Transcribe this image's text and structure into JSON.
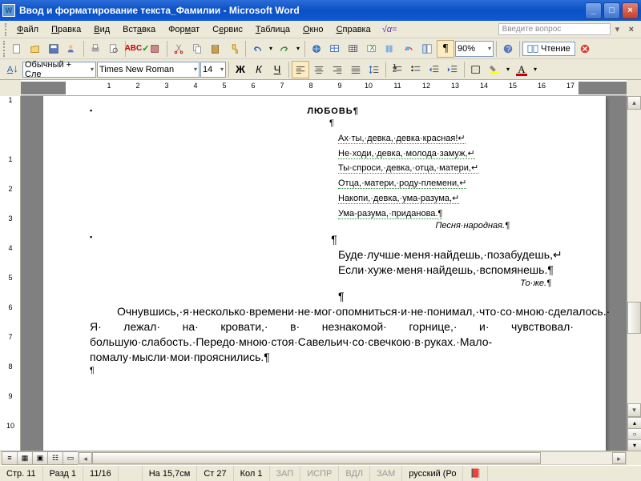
{
  "window": {
    "title": "Ввод и форматирование текста_Фамилии - Microsoft Word"
  },
  "menu": {
    "file": "Файл",
    "edit": "Правка",
    "view": "Вид",
    "insert": "Вставка",
    "format": "Формат",
    "tools": "Сервис",
    "table": "Таблица",
    "window": "Окно",
    "help": "Справка",
    "formula": "√α=",
    "question": "Введите вопрос"
  },
  "tb1": {
    "zoom": "90%",
    "reading": "Чтение"
  },
  "tb2": {
    "style": "Обычный + Сле",
    "font": "Times New Roman",
    "size": "14",
    "bold": "Ж",
    "italic": "К",
    "underline": "Ч"
  },
  "ruler_h": [
    "",
    "1",
    "2",
    "3",
    "4",
    "5",
    "6",
    "7",
    "8",
    "9",
    "10",
    "11",
    "12",
    "13",
    "14",
    "15",
    "16",
    "17"
  ],
  "ruler_v": [
    "1",
    "",
    "1",
    "2",
    "3",
    "4",
    "5",
    "6",
    "7",
    "8",
    "9",
    "10"
  ],
  "doc": {
    "title": "ЛЮБОВЬ¶",
    "p1": "¶",
    "poem": [
      "Ах·ты,·девка,·девка·красная!↵",
      "Не·ходи,·девка,·молода·замуж,↵",
      "Ты·спроси,·девка,·отца,·матери,↵",
      "Отца,·матери,·роду-племени,↵",
      "Накопи,·девка,·ума-разума,↵",
      "Ума-разума,·приданова.¶"
    ],
    "src": "Песня·народная.¶",
    "p2": "¶",
    "poem2": [
      "Буде·лучше·меня·найдешь,·позабудешь,↵",
      "Если·хуже·меня·найдешь,·вспомянешь.¶"
    ],
    "src2": "То·же.¶",
    "p3": "¶",
    "prose": "Очнувшись,·я·несколько·времени·не·мог·опомниться·и·не·понимал,·что·со·мною·сделалось.· Я· лежал· на· кровати,· в· незнакомой· горнице,· и· чувствовал· большую·слабость.·Передо·мною·стоя·Савельич·со·свечкою·в·руках.·Мало-помалу·мысли·мои·прояснились.¶",
    "p4": "¶"
  },
  "status": {
    "page": "Стр. 11",
    "sect": "Разд 1",
    "pages": "11/16",
    "at": "На 15,7см",
    "line": "Ст 27",
    "col": "Кол 1",
    "rec": "ЗАП",
    "trk": "ИСПР",
    "ext": "ВДЛ",
    "ovr": "ЗАМ",
    "lang": "русский (Ро"
  }
}
